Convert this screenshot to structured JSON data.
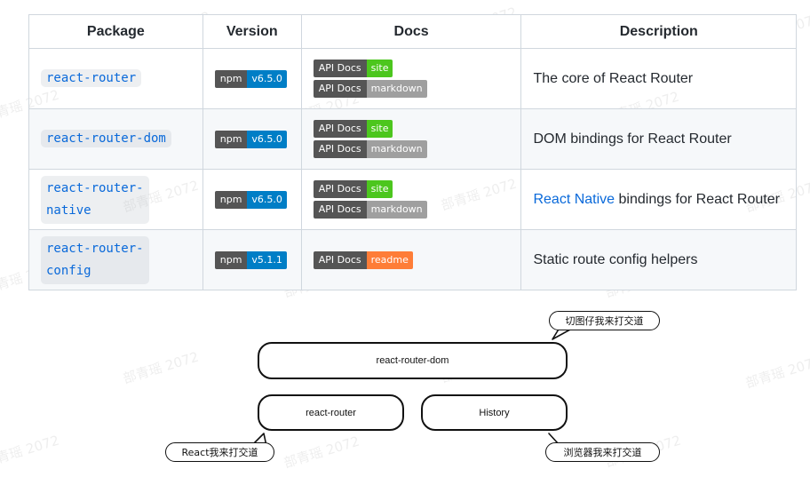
{
  "table": {
    "headers": [
      "Package",
      "Version",
      "Docs",
      "Description"
    ],
    "rows": [
      {
        "package": "react-router",
        "version": {
          "left": "npm",
          "right": "v6.5.0"
        },
        "docs": [
          {
            "left": "API Docs",
            "right": "site"
          },
          {
            "left": "API Docs",
            "right": "markdown"
          }
        ],
        "description_link": "",
        "description": "The core of React Router"
      },
      {
        "package": "react-router-dom",
        "version": {
          "left": "npm",
          "right": "v6.5.0"
        },
        "docs": [
          {
            "left": "API Docs",
            "right": "site"
          },
          {
            "left": "API Docs",
            "right": "markdown"
          }
        ],
        "description_link": "",
        "description": "DOM bindings for React Router"
      },
      {
        "package_line1": "react-router-",
        "package_line2": "native",
        "version": {
          "left": "npm",
          "right": "v6.5.0"
        },
        "docs": [
          {
            "left": "API Docs",
            "right": "site"
          },
          {
            "left": "API Docs",
            "right": "markdown"
          }
        ],
        "description_link": "React Native",
        "description": " bindings for React Router"
      },
      {
        "package_line1": "react-router-",
        "package_line2": "config",
        "version": {
          "left": "npm",
          "right": "v5.1.1"
        },
        "docs": [
          {
            "left": "API Docs",
            "right": "readme"
          }
        ],
        "description_link": "",
        "description": "Static route config helpers"
      }
    ]
  },
  "diagram": {
    "top_box": "react-router-dom",
    "left_box": "react-router",
    "right_box": "History",
    "bubble_top_right": "切图仔我来打交道",
    "bubble_bottom_left": "React我来打交道",
    "bubble_bottom_right": "浏览器我来打交道"
  },
  "watermark": "部青瑶 2072",
  "colors": {
    "badge_label": "#555555",
    "badge_blue": "#007ec6",
    "badge_green": "#4cc61e",
    "badge_gray": "#9f9f9f",
    "badge_orange": "#fe7d37",
    "link": "#0969da",
    "table_border": "#d0d7de",
    "stripe": "#f6f8fa"
  }
}
